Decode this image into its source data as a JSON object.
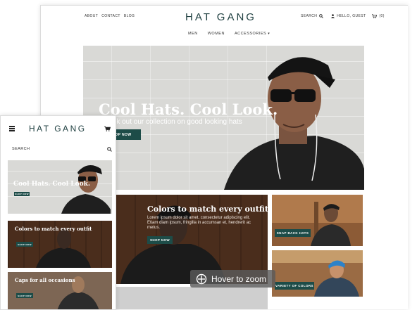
{
  "desktop": {
    "nav_links": [
      "ABOUT",
      "CONTACT",
      "BLOG"
    ],
    "logo": "HAT GANG",
    "search_label": "SEARCH",
    "user_label": "HELLO, GUEST",
    "cart_label": "(0)",
    "categories": [
      "MEN",
      "WOMEN",
      "ACCESSORIES"
    ],
    "hero": {
      "title": "Cool Hats. Cool Look.",
      "subtitle": "Check out our collection on good looking hats",
      "button": "SHOP NOW"
    },
    "promo_main": {
      "title": "Colors to match every outfit",
      "text": "Lorem ipsum dolor sit amet, consectetur adipiscing elit. Etiam diam ipsum, fringilla in accumsan et, hendrerit ac metus.",
      "button": "SHOP NOW"
    },
    "tile_1_button": "SNAP BACK HATS",
    "tile_2_button": "VARIETY OF COLORS"
  },
  "mobile": {
    "logo": "HAT GANG",
    "search_label": "SEARCH",
    "hero": {
      "title": "Cool Hats. Cool Look.",
      "button": "SHOP NOW"
    },
    "promo_1": {
      "title": "Colors to match every outfit",
      "button": "SHOP NOW"
    },
    "promo_2": {
      "title": "Caps for all occasions",
      "button": "SHOP NOW"
    }
  },
  "overlay": {
    "zoom_label": "Hover to zoom"
  },
  "colors": {
    "accent": "#1d4c48",
    "logo": "#1d3e3f"
  }
}
